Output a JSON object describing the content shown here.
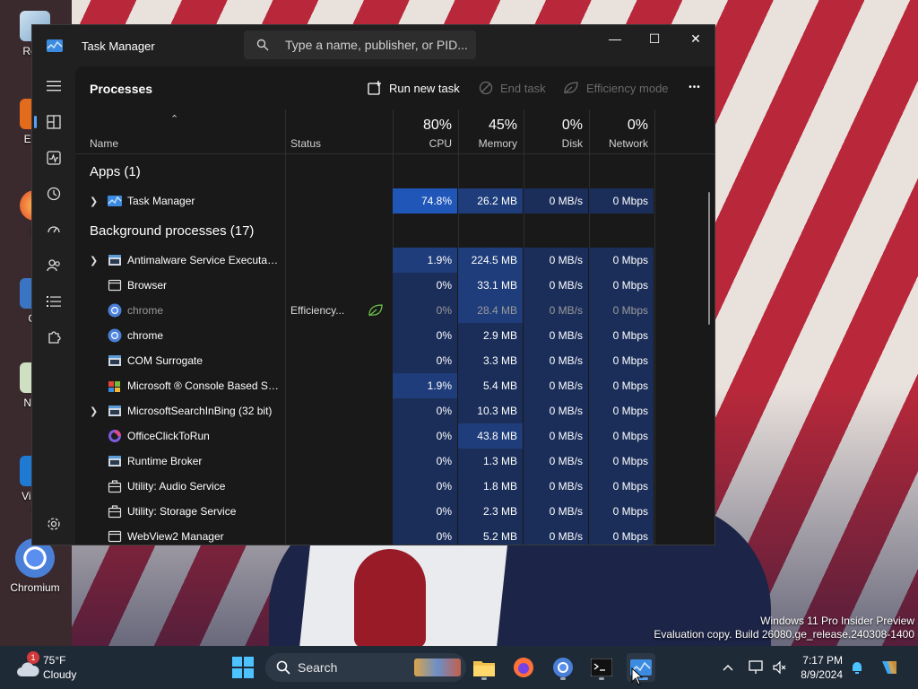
{
  "desktop": {
    "icons": [
      "Recy",
      "Ever",
      "Fi",
      "Git",
      "Note",
      "Visua\nC",
      "Chromium"
    ]
  },
  "window": {
    "title": "Task Manager",
    "search_placeholder": "Type a name, publisher, or PID...",
    "controls": {
      "minimize": "—",
      "maximize": "☐",
      "close": "✕"
    }
  },
  "toolbar": {
    "page_title": "Processes",
    "run_new_task": "Run new task",
    "end_task": "End task",
    "efficiency_mode": "Efficiency mode",
    "more": "•••"
  },
  "columns": {
    "name": "Name",
    "status": "Status",
    "cpu": {
      "pct": "80%",
      "label": "CPU"
    },
    "memory": {
      "pct": "45%",
      "label": "Memory"
    },
    "disk": {
      "pct": "0%",
      "label": "Disk"
    },
    "network": {
      "pct": "0%",
      "label": "Network"
    }
  },
  "groups": {
    "apps": "Apps (1)",
    "background": "Background processes (17)"
  },
  "apps": [
    {
      "name": "Task Manager",
      "status": "",
      "cpu": "74.8%",
      "memory": "26.2 MB",
      "disk": "0 MB/s",
      "network": "0 Mbps",
      "expandable": true,
      "icon": "task-manager-icon"
    }
  ],
  "processes": [
    {
      "name": "Antimalware Service Executable",
      "status": "",
      "cpu": "1.9%",
      "memory": "224.5 MB",
      "disk": "0 MB/s",
      "network": "0 Mbps",
      "expandable": true,
      "icon": "window-icon"
    },
    {
      "name": "Browser",
      "status": "",
      "cpu": "0%",
      "memory": "33.1 MB",
      "disk": "0 MB/s",
      "network": "0 Mbps",
      "expandable": false,
      "icon": "frame-icon"
    },
    {
      "name": "chrome",
      "status": "Efficiency...",
      "cpu": "0%",
      "memory": "28.4 MB",
      "disk": "0 MB/s",
      "network": "0 Mbps",
      "expandable": false,
      "icon": "chromium-icon",
      "dim": true
    },
    {
      "name": "chrome",
      "status": "",
      "cpu": "0%",
      "memory": "2.9 MB",
      "disk": "0 MB/s",
      "network": "0 Mbps",
      "expandable": false,
      "icon": "chromium-icon"
    },
    {
      "name": "COM Surrogate",
      "status": "",
      "cpu": "0%",
      "memory": "3.3 MB",
      "disk": "0 MB/s",
      "network": "0 Mbps",
      "expandable": false,
      "icon": "window-icon"
    },
    {
      "name": "Microsoft ® Console Based Sc...",
      "status": "",
      "cpu": "1.9%",
      "memory": "5.4 MB",
      "disk": "0 MB/s",
      "network": "0 Mbps",
      "expandable": false,
      "icon": "console-icon"
    },
    {
      "name": "MicrosoftSearchInBing (32 bit)",
      "status": "",
      "cpu": "0%",
      "memory": "10.3 MB",
      "disk": "0 MB/s",
      "network": "0 Mbps",
      "expandable": true,
      "icon": "window-icon"
    },
    {
      "name": "OfficeClickToRun",
      "status": "",
      "cpu": "0%",
      "memory": "43.8 MB",
      "disk": "0 MB/s",
      "network": "0 Mbps",
      "expandable": false,
      "icon": "office-icon"
    },
    {
      "name": "Runtime Broker",
      "status": "",
      "cpu": "0%",
      "memory": "1.3 MB",
      "disk": "0 MB/s",
      "network": "0 Mbps",
      "expandable": false,
      "icon": "window-icon"
    },
    {
      "name": "Utility: Audio Service",
      "status": "",
      "cpu": "0%",
      "memory": "1.8 MB",
      "disk": "0 MB/s",
      "network": "0 Mbps",
      "expandable": false,
      "icon": "briefcase-icon"
    },
    {
      "name": "Utility: Storage Service",
      "status": "",
      "cpu": "0%",
      "memory": "2.3 MB",
      "disk": "0 MB/s",
      "network": "0 Mbps",
      "expandable": false,
      "icon": "briefcase-icon"
    },
    {
      "name": "WebView2 Manager",
      "status": "",
      "cpu": "0%",
      "memory": "5.2 MB",
      "disk": "0 MB/s",
      "network": "0 Mbps",
      "expandable": false,
      "icon": "frame-icon"
    }
  ],
  "colors": {
    "heat_low": "#1b2e5a",
    "heat_mid": "#1f3d7a",
    "heat_high": "#1f56b8",
    "accent": "#5aa0f0",
    "window_bg": "#202020",
    "table_bg": "#191919"
  },
  "watermark": {
    "line1": "Windows 11 Pro Insider Preview",
    "line2": "Evaluation copy. Build 26080.ge_release.240308-1400"
  },
  "taskbar": {
    "weather_temp": "75°F",
    "weather_desc": "Cloudy",
    "weather_badge": "1",
    "search_label": "Search",
    "time": "7:17 PM",
    "date": "8/9/2024"
  }
}
